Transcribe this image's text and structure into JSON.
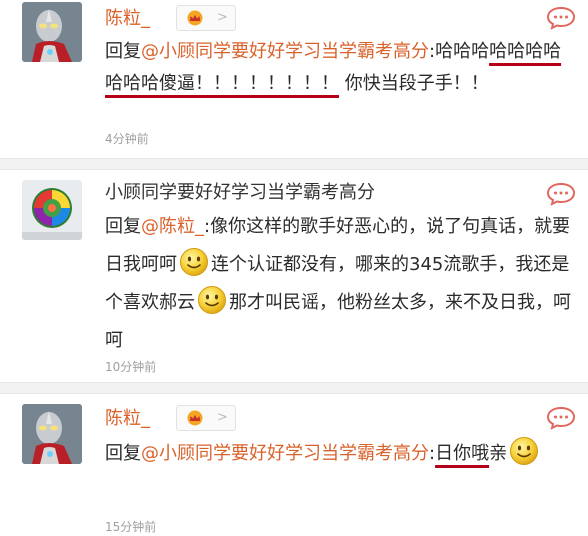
{
  "comments": [
    {
      "author": "陈粒_",
      "reply_prefix": "回复",
      "mention": "@小顾同学要好好学习当学霸考高分",
      "text_a": ":哈哈哈",
      "text_b": "哈哈哈哈哈哈哈傻逼！！！！！！！！",
      "text_c": " 你快当段子手！！",
      "time": "4分钟前"
    },
    {
      "author": "小顾同学要好好学习当学霸考高分",
      "reply_prefix": "回复",
      "mention": "@陈粒_",
      "text_a": ":像你这样的歌手好恶心的，说了句真话，就要日我呵呵",
      "text_b": "连个认证都没有，哪来的345流歌手，我还是个喜欢郝云",
      "text_c": "那才叫民谣，他粉丝太多，来不及日我，呵呵",
      "time": "10分钟前"
    },
    {
      "author": "陈粒_",
      "reply_prefix": "回复",
      "mention": "@小顾同学要好好学习当学霸考高分",
      "text_a": ":",
      "text_b": "日你哦",
      "text_c": "亲",
      "time": "15分钟前"
    }
  ],
  "colors": {
    "mention": "#d9622b",
    "underline": "#b5001a",
    "separator": "#f2f2f2",
    "time": "#a0a0a0"
  },
  "icons": [
    "avatar-ultraman",
    "avatar-rainbow-rose",
    "crown-icon",
    "chevron-right-icon",
    "comment-icon",
    "smile-emoji"
  ]
}
